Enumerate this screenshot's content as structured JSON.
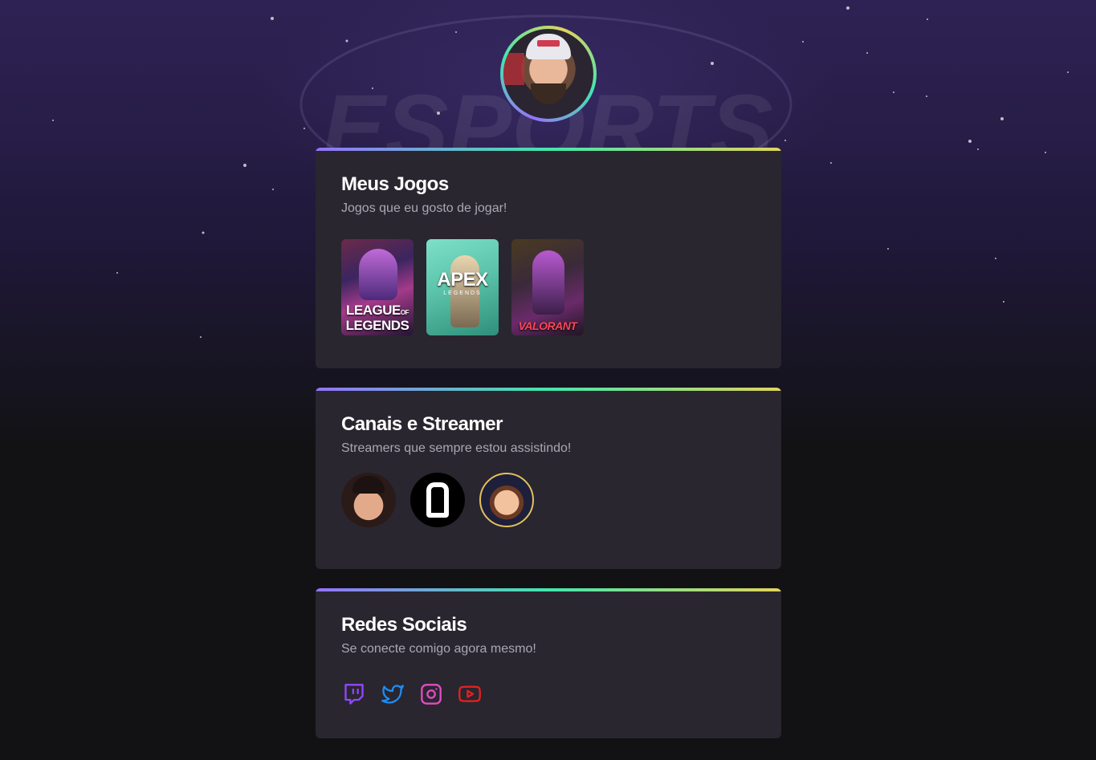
{
  "profile": {
    "avatar_icon": "avatar-photo"
  },
  "background": {
    "watermark_text": "ESPORTS"
  },
  "games_card": {
    "title": "Meus Jogos",
    "subtitle": "Jogos que eu gosto de jogar!",
    "games": [
      {
        "name": "League of Legends",
        "logo_line1": "LEAGUE",
        "logo_of": "OF",
        "logo_line2": "LEGENDS"
      },
      {
        "name": "Apex Legends",
        "logo_line1": "APEX",
        "logo_line2": "LEGENDS"
      },
      {
        "name": "Valorant",
        "logo_line1": "VALORANT"
      }
    ]
  },
  "streamers_card": {
    "title": "Canais e Streamer",
    "subtitle": "Streamers que sempre estou assistindo!"
  },
  "social_card": {
    "title": "Redes Sociais",
    "subtitle": "Se conecte comigo agora mesmo!",
    "links": [
      {
        "name": "twitch",
        "icon": "twitch-icon",
        "color": "#9147ff"
      },
      {
        "name": "twitter",
        "icon": "twitter-icon",
        "color": "#1d8cf5"
      },
      {
        "name": "instagram",
        "icon": "instagram-icon",
        "color": "#e34bc4"
      },
      {
        "name": "youtube",
        "icon": "youtube-icon",
        "color": "#e52020"
      }
    ]
  },
  "colors": {
    "page_bg": "#121214",
    "card_bg": "#29262f",
    "gradient_start": "#9572fc",
    "gradient_mid": "#43e7ad",
    "gradient_end": "#e2d45c"
  }
}
